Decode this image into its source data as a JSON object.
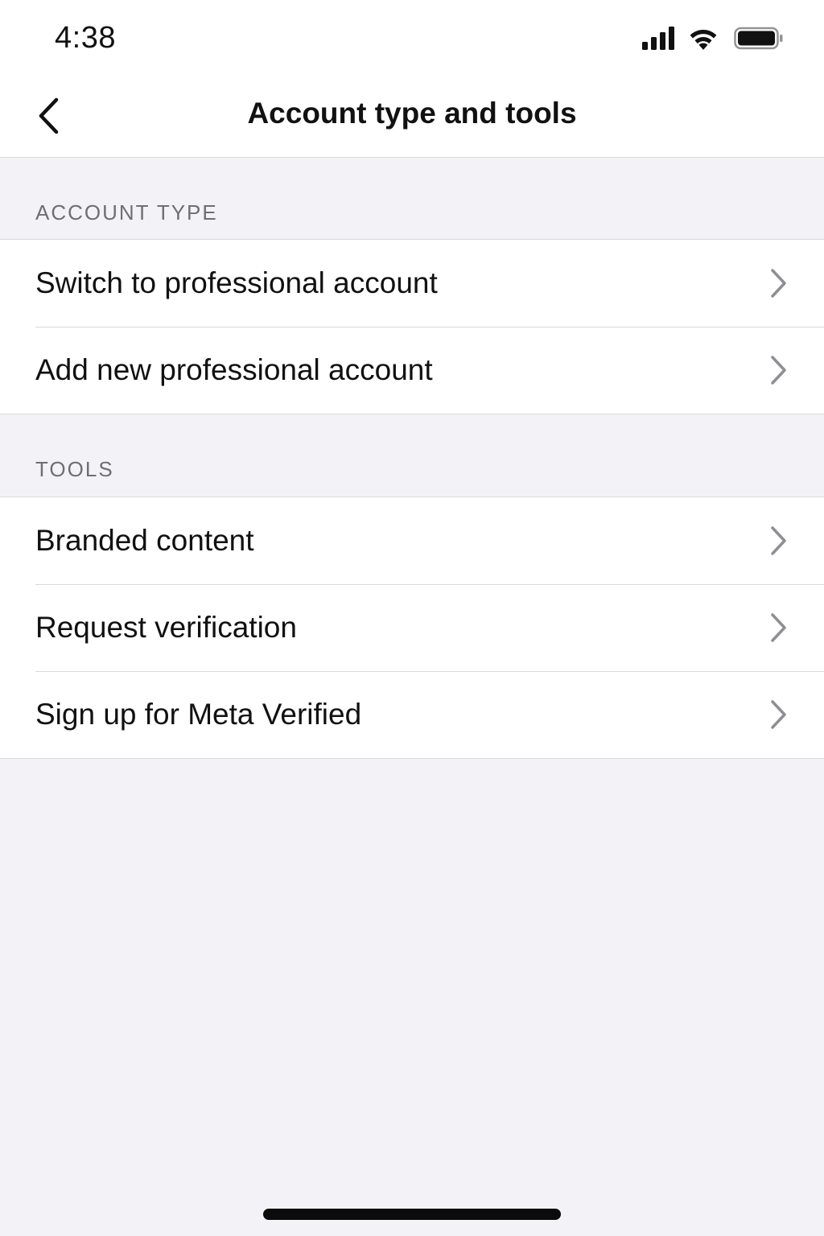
{
  "status_bar": {
    "time": "4:38",
    "icons": [
      "cellular-signal-icon",
      "wifi-icon",
      "battery-icon"
    ]
  },
  "nav": {
    "back_icon": "chevron-left-icon",
    "title": "Account type and tools"
  },
  "sections": [
    {
      "header": "ACCOUNT TYPE",
      "items": [
        {
          "label": "Switch to professional account",
          "icon": "chevron-right-icon"
        },
        {
          "label": "Add new professional account",
          "icon": "chevron-right-icon"
        }
      ]
    },
    {
      "header": "TOOLS",
      "items": [
        {
          "label": "Branded content",
          "icon": "chevron-right-icon"
        },
        {
          "label": "Request verification",
          "icon": "chevron-right-icon"
        },
        {
          "label": "Sign up for Meta Verified",
          "icon": "chevron-right-icon"
        }
      ]
    }
  ],
  "colors": {
    "background": "#f3f3f7",
    "surface": "#ffffff",
    "separator": "#d9d9de",
    "section_header_text": "#6e6e73",
    "chevron": "#8e8e93",
    "text_primary": "#111111"
  }
}
